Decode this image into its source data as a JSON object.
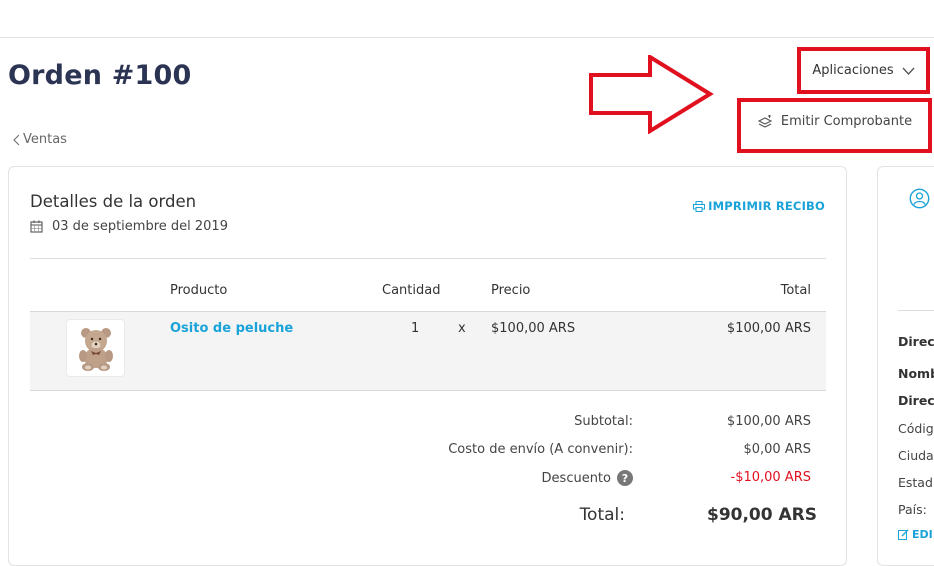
{
  "header": {
    "title": "Orden #100",
    "back_label": "Ventas"
  },
  "apps_menu": {
    "label": "Aplicaciones",
    "item_label": "Emitir Comprobante"
  },
  "order": {
    "section_title": "Detalles de la orden",
    "date": "03 de septiembre del 2019",
    "print_label": "IMPRIMIR RECIBO",
    "columns": {
      "product": "Producto",
      "quantity": "Cantidad",
      "price": "Precio",
      "total": "Total"
    },
    "item": {
      "name": "Osito de peluche",
      "quantity": "1",
      "times": "x",
      "price": "$100,00 ARS",
      "total": "$100,00 ARS"
    },
    "summary": {
      "subtotal_label": "Subtotal:",
      "subtotal_value": "$100,00 ARS",
      "shipping_label": "Costo de envío (A convenir):",
      "shipping_value": "$0,00 ARS",
      "discount_label": "Descuento",
      "discount_help": "?",
      "discount_value": "-$10,00 ARS",
      "total_label": "Total:",
      "total_value": "$90,00 ARS"
    }
  },
  "side_card": {
    "labels": [
      "Direc",
      "Nomb",
      "Direc",
      "Códig",
      "Ciuda",
      "Estad",
      "País:"
    ],
    "edit_label": "EDI"
  },
  "colors": {
    "accent": "#1aa3d9",
    "title": "#2b3452",
    "annotation_red": "#e0101f"
  }
}
